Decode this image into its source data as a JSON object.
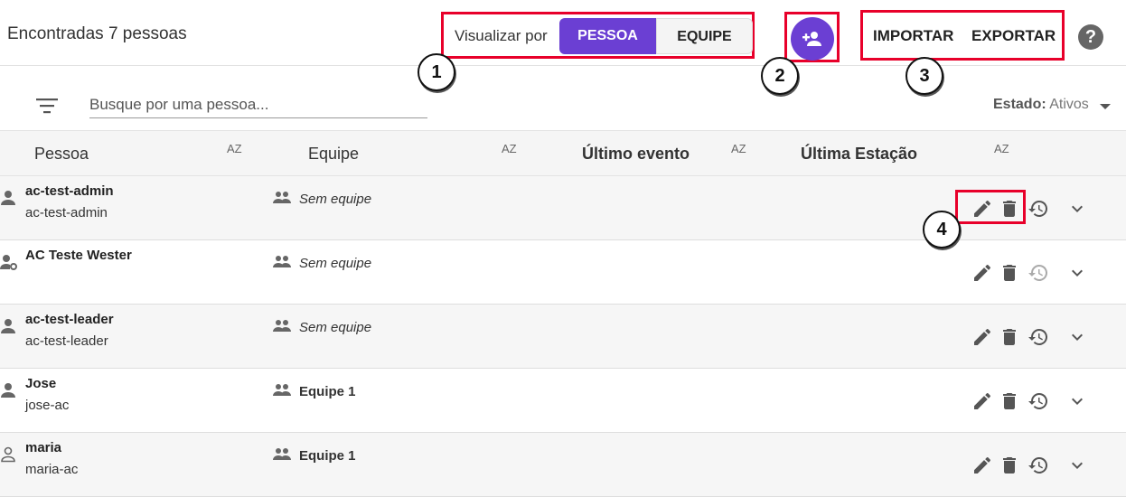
{
  "header": {
    "found_text": "Encontradas 7 pessoas",
    "view_by_label": "Visualizar por",
    "view_person": "PESSOA",
    "view_team": "EQUIPE",
    "import_label": "IMPORTAR",
    "export_label": "EXPORTAR",
    "add_icon": "person-add-icon",
    "help_icon": "help-icon",
    "help_glyph": "?"
  },
  "callouts": [
    "1",
    "2",
    "3",
    "4"
  ],
  "filter": {
    "search_placeholder": "Busque por uma pessoa...",
    "state_label": "Estado:",
    "state_value": "Ativos"
  },
  "table": {
    "columns": [
      "Pessoa",
      "Equipe",
      "Último evento",
      "Última Estação"
    ],
    "sort_glyph": "AZ",
    "rows": [
      {
        "name": "ac-test-admin",
        "login": "ac-test-admin",
        "team": "Sem equipe",
        "icon": "person-icon"
      },
      {
        "name": "AC Teste Wester",
        "login": "",
        "team": "Sem equipe",
        "icon": "person-gear-icon"
      },
      {
        "name": "ac-test-leader",
        "login": "ac-test-leader",
        "team": "Sem equipe",
        "icon": "person-icon"
      },
      {
        "name": "Jose",
        "login": "jose-ac",
        "team": "Equipe 1",
        "icon": "person-icon"
      },
      {
        "name": "maria",
        "login": "maria-ac",
        "team": "Equipe 1",
        "icon": "person-outline-icon"
      }
    ]
  },
  "colors": {
    "accent": "#6b3fd3",
    "highlight": "#e8002a"
  }
}
